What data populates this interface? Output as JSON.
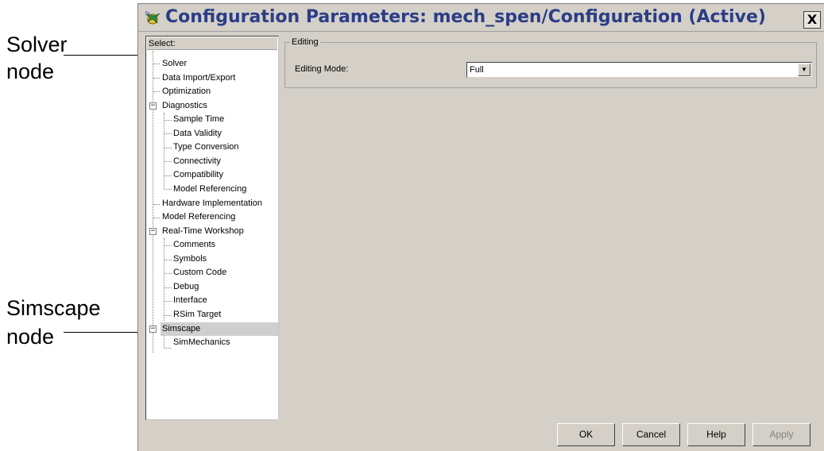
{
  "callouts": [
    {
      "line1": "Solver",
      "line2": "node"
    },
    {
      "line1": "Simscape",
      "line2": "node"
    }
  ],
  "window": {
    "title": "Configuration Parameters: mech_spen/Configuration (Active)",
    "close_label": "X",
    "icon": "simulink-model-icon"
  },
  "tree": {
    "header": "Select:",
    "items": [
      {
        "label": "Solver",
        "level": 0
      },
      {
        "label": "Data Import/Export",
        "level": 0
      },
      {
        "label": "Optimization",
        "level": 0
      },
      {
        "label": "Diagnostics",
        "level": 0,
        "expanded": true
      },
      {
        "label": "Sample Time",
        "level": 1
      },
      {
        "label": "Data Validity",
        "level": 1
      },
      {
        "label": "Type Conversion",
        "level": 1
      },
      {
        "label": "Connectivity",
        "level": 1
      },
      {
        "label": "Compatibility",
        "level": 1
      },
      {
        "label": "Model Referencing",
        "level": 1
      },
      {
        "label": "Hardware Implementation",
        "level": 0
      },
      {
        "label": "Model Referencing",
        "level": 0
      },
      {
        "label": "Real-Time Workshop",
        "level": 0,
        "expanded": true
      },
      {
        "label": "Comments",
        "level": 1
      },
      {
        "label": "Symbols",
        "level": 1
      },
      {
        "label": "Custom Code",
        "level": 1
      },
      {
        "label": "Debug",
        "level": 1
      },
      {
        "label": "Interface",
        "level": 1
      },
      {
        "label": "RSim Target",
        "level": 1
      },
      {
        "label": "Simscape",
        "level": 0,
        "expanded": true,
        "selected": true
      },
      {
        "label": "SimMechanics",
        "level": 1
      }
    ]
  },
  "editing": {
    "group_title": "Editing",
    "mode_label": "Editing Mode:",
    "mode_value": "Full"
  },
  "buttons": {
    "ok": "OK",
    "cancel": "Cancel",
    "help": "Help",
    "apply": "Apply"
  },
  "colors": {
    "title_text": "#2c3d87",
    "dialog_bg": "#d4d0c8",
    "selection": "#cfcfcf"
  }
}
